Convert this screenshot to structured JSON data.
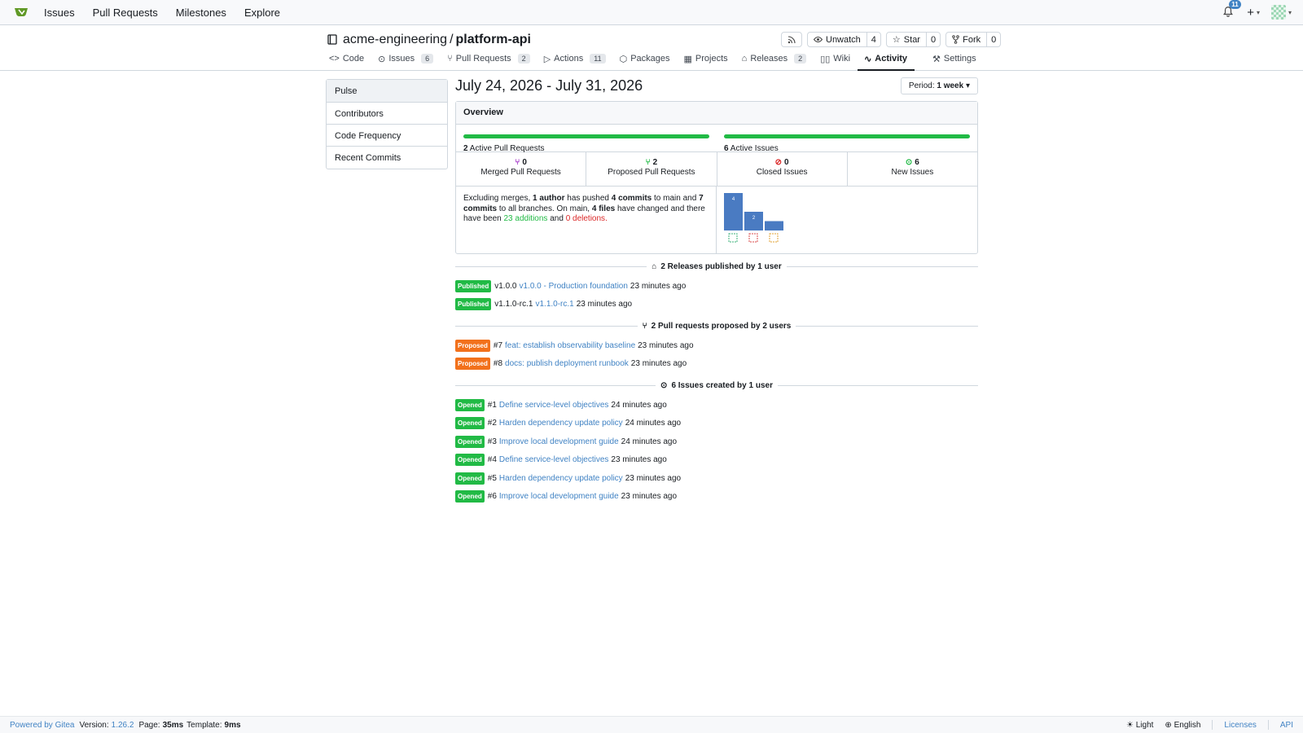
{
  "topnav": {
    "items": [
      "Issues",
      "Pull Requests",
      "Milestones",
      "Explore"
    ],
    "notifications": "11"
  },
  "repo": {
    "owner": "acme-engineering",
    "separator": "/",
    "name": "platform-api",
    "unwatch_label": "Unwatch",
    "watch_count": "4",
    "star_label": "Star",
    "star_count": "0",
    "fork_label": "Fork",
    "fork_count": "0"
  },
  "tabs": [
    {
      "label": "Code"
    },
    {
      "label": "Issues",
      "count": "6"
    },
    {
      "label": "Pull Requests",
      "count": "2"
    },
    {
      "label": "Actions",
      "count": "11"
    },
    {
      "label": "Packages"
    },
    {
      "label": "Projects"
    },
    {
      "label": "Releases",
      "count": "2"
    },
    {
      "label": "Wiki"
    },
    {
      "label": "Activity"
    }
  ],
  "settings_label": "Settings",
  "sidebar": {
    "items": [
      "Pulse",
      "Contributors",
      "Code Frequency",
      "Recent Commits"
    ]
  },
  "main": {
    "title": "July 24, 2026 - July 31, 2026",
    "period_prefix": "Period:",
    "period_value": "1 week",
    "overview_title": "Overview",
    "active_prs_count": "2",
    "active_prs_label": "Active Pull Requests",
    "active_issues_count": "6",
    "active_issues_label": "Active Issues",
    "stats": [
      {
        "value": "0",
        "label": "Merged Pull Requests",
        "color": "#a333c8"
      },
      {
        "value": "2",
        "label": "Proposed Pull Requests",
        "color": "#21ba45"
      },
      {
        "value": "0",
        "label": "Closed Issues",
        "color": "#db2828"
      },
      {
        "value": "6",
        "label": "New Issues",
        "color": "#21ba45"
      }
    ],
    "commits": {
      "t1": "Excluding merges,",
      "author": "1 author",
      "t2": "has pushed",
      "commits_main": "4 commits",
      "t3": "to main and",
      "commits_all": "7 commits",
      "t4": "to all branches. On main,",
      "files": "4 files",
      "t5": "have changed and there have been",
      "additions": "23 additions",
      "t6": "and",
      "deletions": "0 deletions",
      "t7": "."
    },
    "chart_data": {
      "type": "bar",
      "values": [
        4,
        2,
        1
      ],
      "data_labels": [
        "4",
        "2",
        ""
      ],
      "color": "#4a7bc2"
    },
    "releases_header": "2 Releases published by 1 user",
    "releases": [
      {
        "badge": "Published",
        "tag": "v1.0.0",
        "title": "v1.0.0 - Production foundation",
        "time": "23 minutes ago"
      },
      {
        "badge": "Published",
        "tag": "v1.1.0-rc.1",
        "title": "v1.1.0-rc.1",
        "time": "23 minutes ago"
      }
    ],
    "prs_header": "2 Pull requests proposed by 2 users",
    "prs": [
      {
        "badge": "Proposed",
        "num": "#7",
        "title": "feat: establish observability baseline",
        "time": "23 minutes ago"
      },
      {
        "badge": "Proposed",
        "num": "#8",
        "title": "docs: publish deployment runbook",
        "time": "23 minutes ago"
      }
    ],
    "issues_header": "6 Issues created by 1 user",
    "issues": [
      {
        "badge": "Opened",
        "num": "#1",
        "title": "Define service-level objectives",
        "time": "24 minutes ago"
      },
      {
        "badge": "Opened",
        "num": "#2",
        "title": "Harden dependency update policy",
        "time": "24 minutes ago"
      },
      {
        "badge": "Opened",
        "num": "#3",
        "title": "Improve local development guide",
        "time": "24 minutes ago"
      },
      {
        "badge": "Opened",
        "num": "#4",
        "title": "Define service-level objectives",
        "time": "23 minutes ago"
      },
      {
        "badge": "Opened",
        "num": "#5",
        "title": "Harden dependency update policy",
        "time": "23 minutes ago"
      },
      {
        "badge": "Opened",
        "num": "#6",
        "title": "Improve local development guide",
        "time": "23 minutes ago"
      }
    ]
  },
  "footer": {
    "powered": "Powered by Gitea",
    "version_label": "Version:",
    "version": "1.26.2",
    "page_label": "Page:",
    "page_time": "35ms",
    "template_label": "Template:",
    "template_time": "9ms",
    "theme": "Light",
    "language": "English",
    "licenses": "Licenses",
    "api": "API"
  }
}
